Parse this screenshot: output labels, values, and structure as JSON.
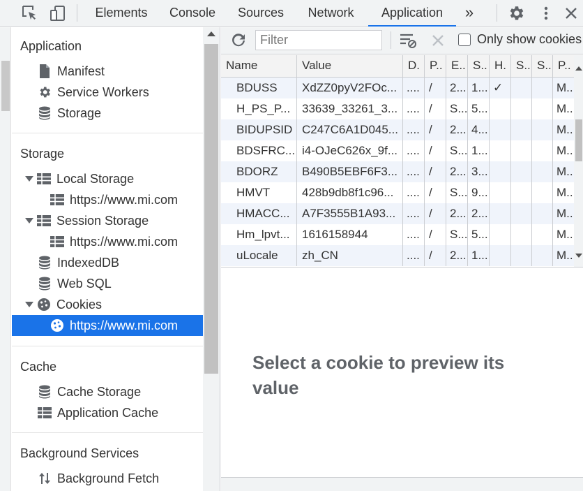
{
  "tabs": [
    {
      "label": "Elements"
    },
    {
      "label": "Console"
    },
    {
      "label": "Sources"
    },
    {
      "label": "Network"
    },
    {
      "label": "Application",
      "active": true
    }
  ],
  "more_tabs_glyph": "»",
  "sidebar": {
    "application": {
      "title": "Application",
      "items": [
        {
          "label": "Manifest",
          "icon": "document-icon"
        },
        {
          "label": "Service Workers",
          "icon": "gear-icon"
        },
        {
          "label": "Storage",
          "icon": "database-icon"
        }
      ]
    },
    "storage": {
      "title": "Storage",
      "local_storage": {
        "label": "Local Storage",
        "child": "https://www.mi.com"
      },
      "session_storage": {
        "label": "Session Storage",
        "child": "https://www.mi.com"
      },
      "indexeddb": {
        "label": "IndexedDB"
      },
      "websql": {
        "label": "Web SQL"
      },
      "cookies": {
        "label": "Cookies",
        "child": "https://www.mi.com"
      }
    },
    "cache": {
      "title": "Cache",
      "items": [
        {
          "label": "Cache Storage",
          "icon": "database-icon"
        },
        {
          "label": "Application Cache",
          "icon": "grid-icon"
        }
      ]
    },
    "background": {
      "title": "Background Services",
      "items": [
        {
          "label": "Background Fetch",
          "icon": "up-down-arrows-icon"
        }
      ]
    }
  },
  "toolbar": {
    "filter_placeholder": "Filter",
    "only_issues_label": "Only show cookies"
  },
  "table": {
    "columns": [
      "Name",
      "Value",
      "D.",
      "P..",
      "E..",
      "S..",
      "H.",
      "S..",
      "S..",
      "P.."
    ],
    "rows": [
      [
        "BDUSS",
        "XdZZ0pyV2FOc...",
        "....",
        "/",
        "2...",
        "1...",
        "✓",
        "",
        "",
        "M..."
      ],
      [
        "H_PS_P...",
        "33639_33261_3...",
        "....",
        "/",
        "S...",
        "5...",
        "",
        "",
        "",
        "M..."
      ],
      [
        "BIDUPSID",
        "C247C6A1D045...",
        "....",
        "/",
        "2...",
        "4...",
        "",
        "",
        "",
        "M..."
      ],
      [
        "BDSFRC...",
        "i4-OJeC626x_9f...",
        "....",
        "/",
        "S...",
        "1...",
        "",
        "",
        "",
        "M..."
      ],
      [
        "BDORZ",
        "B490B5EBF6F3...",
        "....",
        "/",
        "2...",
        "3...",
        "",
        "",
        "",
        "M..."
      ],
      [
        "HMVT",
        "428b9db8f1c96...",
        "....",
        "/",
        "S...",
        "9...",
        "",
        "",
        "",
        "M..."
      ],
      [
        "HMACC...",
        "A7F3555B1A93...",
        "....",
        "/",
        "2...",
        "2...",
        "",
        "",
        "",
        "M..."
      ],
      [
        "Hm_lpvt...",
        "1616158944",
        "....",
        "/",
        "S...",
        "5...",
        "",
        "",
        "",
        "M..."
      ],
      [
        "uLocale",
        "zh_CN",
        "....",
        "/",
        "2...",
        "1...",
        "",
        "",
        "",
        "M..."
      ]
    ]
  },
  "preview_message": "Select a cookie to preview its value",
  "colors": {
    "accent": "#1a73e8",
    "toolbar_bg": "#f1f3f4"
  }
}
